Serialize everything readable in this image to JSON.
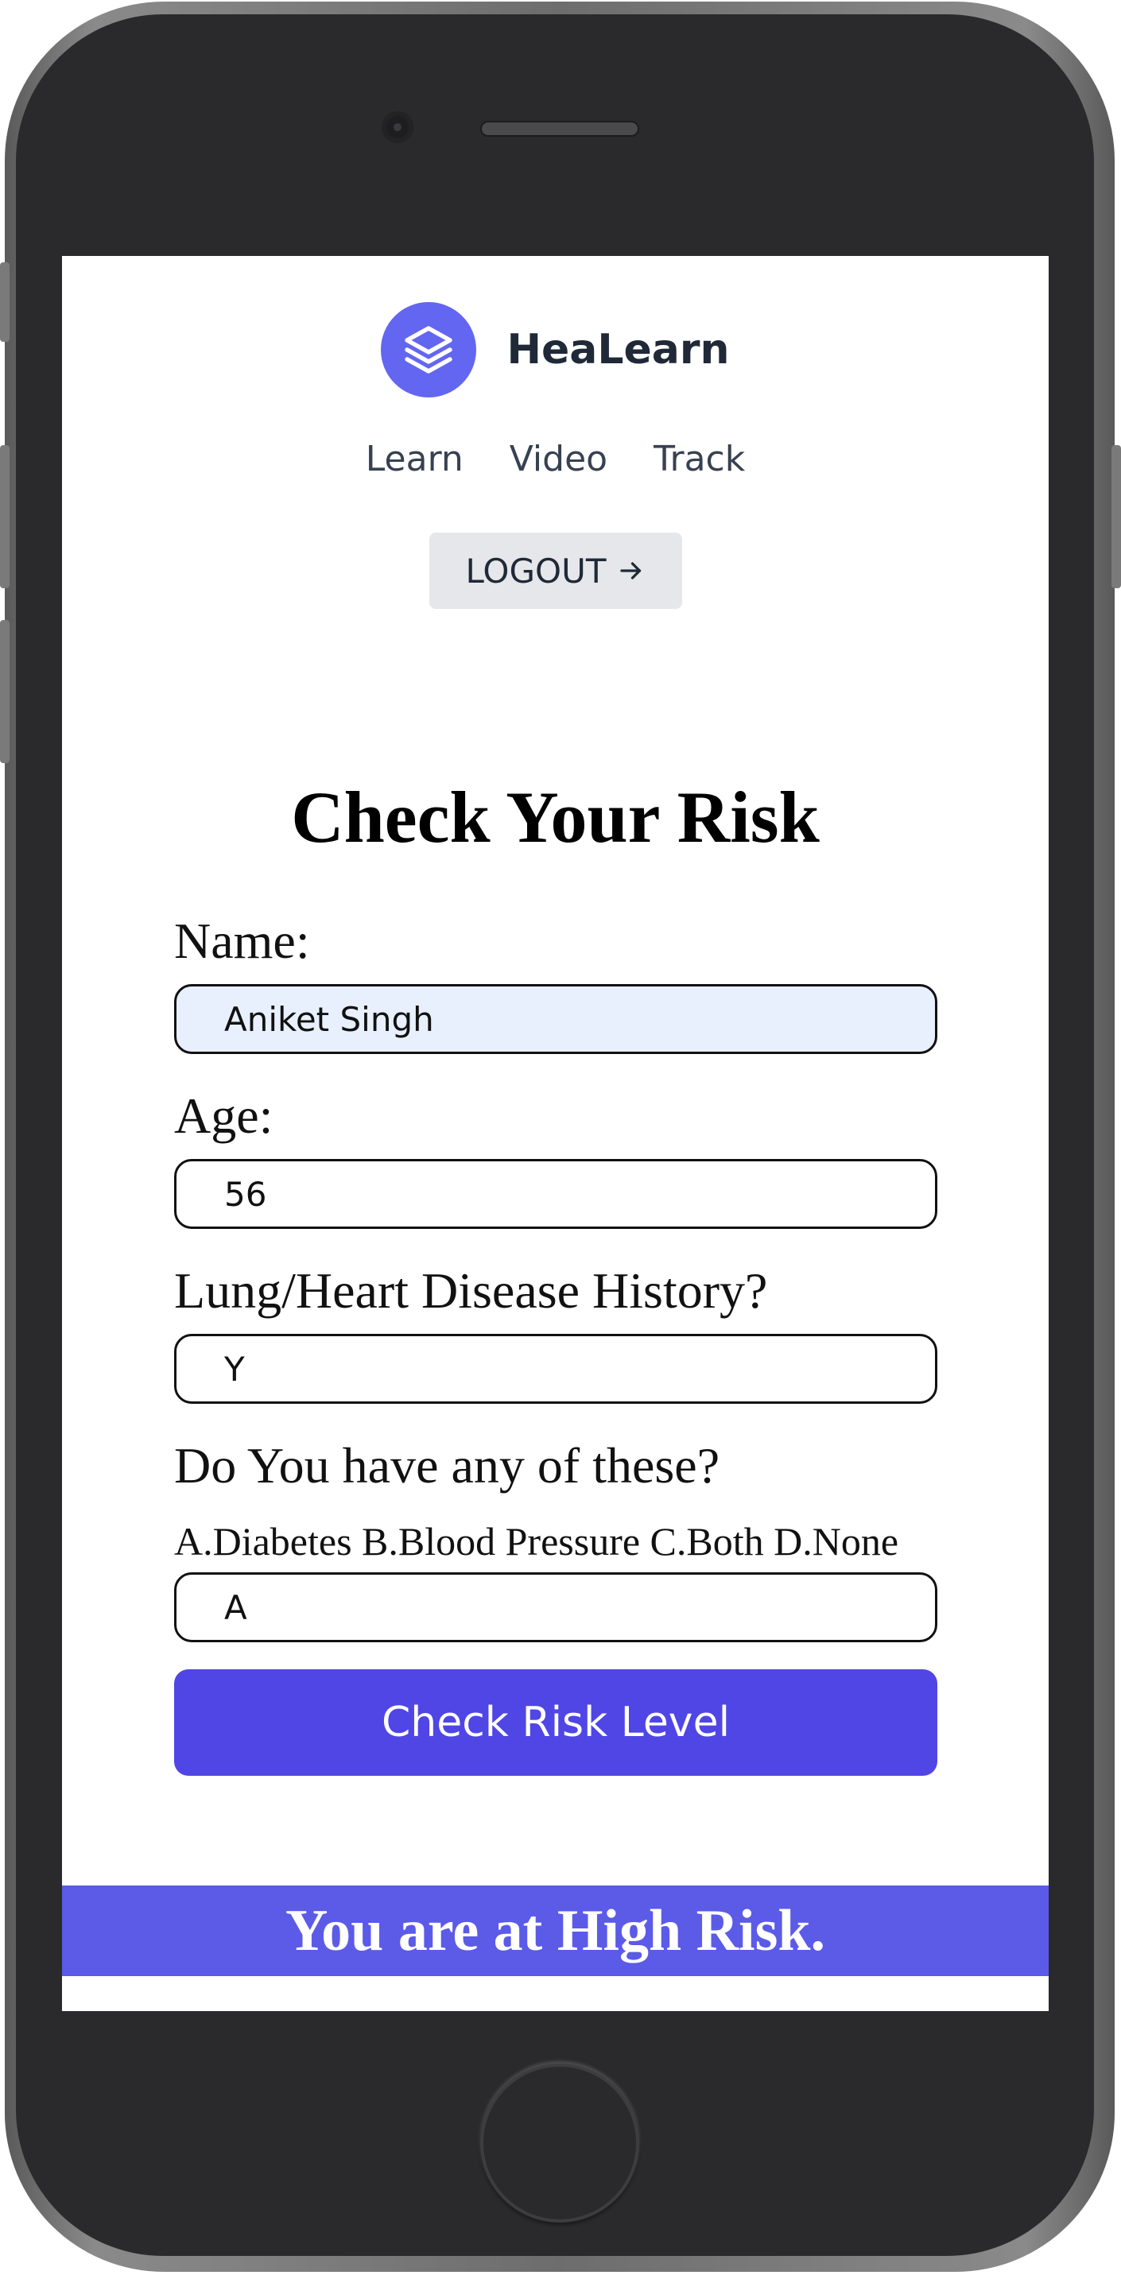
{
  "app": {
    "name": "HeaLearn",
    "logo_icon": "stacked-layers-icon",
    "accent_color": "#6366f1"
  },
  "nav": {
    "items": [
      {
        "label": "Learn"
      },
      {
        "label": "Video"
      },
      {
        "label": "Track"
      }
    ],
    "logout_label": "LOGOUT",
    "logout_icon": "arrow-right-icon"
  },
  "form": {
    "title": "Check Your Risk",
    "name_label": "Name:",
    "name_value": "Aniket Singh",
    "age_label": "Age:",
    "age_value": "56",
    "history_label": "Lung/Heart Disease History?",
    "history_value": "Y",
    "conditions_label": "Do You have any of these?",
    "conditions_options": "A.Diabetes B.Blood Pressure C.Both D.None",
    "conditions_value": "A",
    "submit_label": "Check Risk Level",
    "submit_color": "#4f46e5"
  },
  "result": {
    "text": "You are at High Risk.",
    "color": "#5b5be8"
  }
}
